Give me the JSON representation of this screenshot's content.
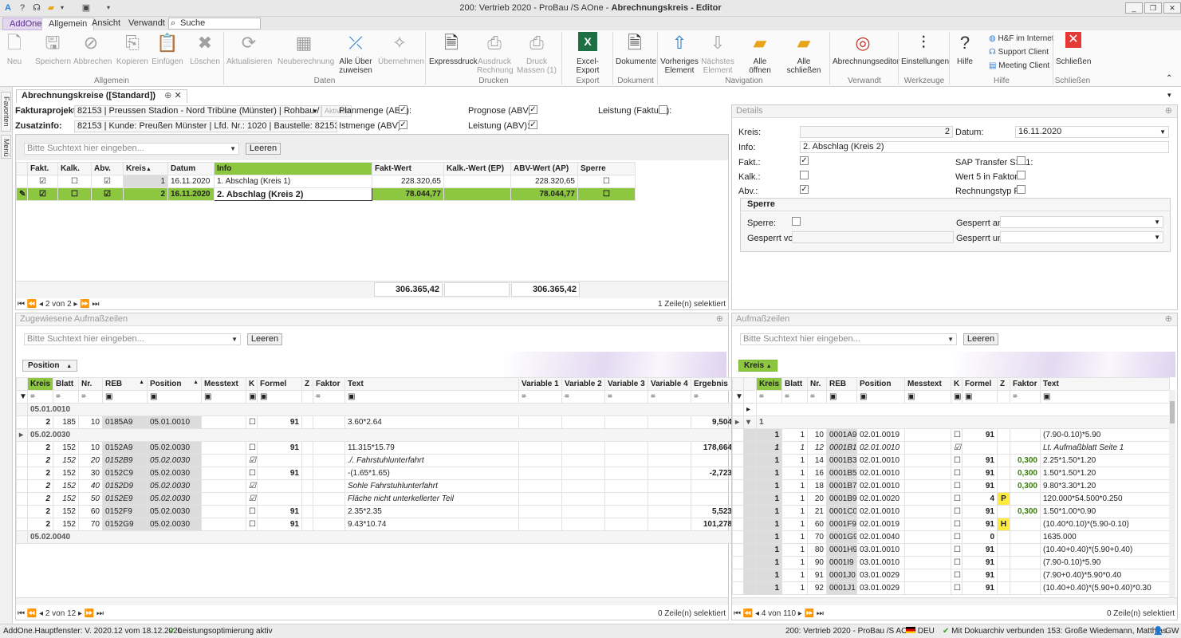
{
  "app": {
    "title": "200: Vertrieb 2020 - ProBau /S AOne - Abrechnungskreis - Editor",
    "title_prefix": "200: Vertrieb 2020 - ProBau /S AOne - ",
    "title_bold": "Abrechnungskreis - Editor"
  },
  "ribbon_tabs": [
    "AddOne",
    "Allgemein",
    "Ansicht",
    "Verwandt"
  ],
  "ribbon_search": "Suche",
  "ribbon": {
    "allgemein": [
      "Neu",
      "Speichern",
      "Abbrechen",
      "Kopieren",
      "Einfügen",
      "Löschen"
    ],
    "daten": [
      "Aktualisieren",
      "Neuberechnung",
      "Alle Über zuweisen",
      "Übernehmen"
    ],
    "drucken": [
      "Expressdruck",
      "Ausdruck Rechnung",
      "Druck Massen (1)"
    ],
    "export": "Excel-Export",
    "dokument": "Dokumente",
    "navigation": [
      "Vorheriges Element",
      "Nächstes Element",
      "Alle öffnen",
      "Alle schließen"
    ],
    "verwandt": "Abrechnungseditor",
    "werkzeuge": "Einstellungen",
    "hilfe": "Hilfe",
    "hilfe_links": [
      "H&F im Internet",
      "Support Client",
      "Meeting Client"
    ],
    "schliessen": "Schließen",
    "groups": [
      "Allgemein",
      "Daten",
      "Drucken",
      "Export",
      "Dokument",
      "Navigation",
      "Verwandt",
      "Werkzeuge",
      "Hilfe",
      "Schließen"
    ]
  },
  "side_tabs": [
    "Favoriten",
    "Menü"
  ],
  "doc_tab": "Abrechnungskreise ([Standard])",
  "top": {
    "fakturaprojekt_label": "Fakturaprojekt:",
    "fakturaprojekt": "82153 | Preussen Stadion - Nord Tribüne (Münster) | Rohbau / Erdarbeiten",
    "aktiviert": "Aktiviert",
    "zusatzinfo_label": "Zusatzinfo:",
    "zusatzinfo": "82153 | Kunde: Preußen Münster | Lfd. Nr.: 1020 | Baustelle: 82153",
    "planmenge": "Planmenge (ABV):",
    "istmenge": "Istmenge (ABV):",
    "prognose": "Prognose (ABV):",
    "leistung_abv": "Leistung (ABV):",
    "leistung_faktura": "Leistung (Faktura):",
    "search_placeholder": "Bitte Suchtext hier eingeben...",
    "leeren": "Leeren",
    "columns": [
      "Fakt.",
      "Kalk.",
      "Abv.",
      "Kreis",
      "Datum",
      "Info",
      "Fakt-Wert",
      "Kalk.-Wert (EP)",
      "ABV-Wert (AP)",
      "Sperre"
    ],
    "rows": [
      {
        "fakt": true,
        "kalk": false,
        "abv": true,
        "kreis": "1",
        "datum": "16.11.2020",
        "info": "1. Abschlag (Kreis 1)",
        "fakt_wert": "228.320,65",
        "kalk_wert": "",
        "abv_wert": "228.320,65",
        "sperre": false
      },
      {
        "fakt": true,
        "kalk": false,
        "abv": true,
        "kreis": "2",
        "datum": "16.11.2020",
        "info": "2. Abschlag (Kreis 2)",
        "fakt_wert": "78.044,77",
        "kalk_wert": "",
        "abv_wert": "78.044,77",
        "sperre": false
      }
    ],
    "sum_fakt": "306.365,42",
    "sum_abv": "306.365,42",
    "nav": "2 von 2",
    "selected": "1 Zeile(n) selektiert"
  },
  "details": {
    "title": "Details",
    "kreis_label": "Kreis:",
    "kreis": "2",
    "datum_label": "Datum:",
    "datum": "16.11.2020",
    "info_label": "Info:",
    "info": "2. Abschlag (Kreis 2)",
    "fakt": "Fakt.:",
    "kalk": "Kalk.:",
    "abv": "Abv.:",
    "sap": "SAP Transfer SS11:",
    "wert5": "Wert 5 in Faktor:",
    "rechnungstyp": "Rechnungstyp R:",
    "sperre_title": "Sperre",
    "sperre": "Sperre:",
    "gesperrt_am": "Gesperrt am:",
    "gesperrt_von": "Gesperrt von:",
    "gesperrt_um": "Gesperrt um:"
  },
  "left_grid": {
    "title": "Zugewiesene Aufmaßzeilen",
    "search_placeholder": "Bitte Suchtext hier eingeben...",
    "leeren": "Leeren",
    "group_chip": "Position",
    "columns": [
      "Kreis",
      "Blatt",
      "Nr.",
      "REB",
      "Position",
      "Messtext",
      "K",
      "Formel",
      "Z",
      "Faktor",
      "Text",
      "Variable 1",
      "Variable 2",
      "Variable 3",
      "Variable 4",
      "Ergebnis"
    ],
    "groups": [
      {
        "name": "05.01.0010",
        "rows": [
          {
            "kreis": "2",
            "blatt": "185",
            "nr": "10",
            "reb": "0185A9",
            "pos": "05.01.0010",
            "k": false,
            "formel": "91",
            "text": "3.60*2.64",
            "erg": "9,504",
            "it": false
          }
        ]
      },
      {
        "name": "05.02.0030",
        "rows": [
          {
            "kreis": "2",
            "blatt": "152",
            "nr": "10",
            "reb": "0152A9",
            "pos": "05.02.0030",
            "k": false,
            "formel": "91",
            "text": "11.315*15.79",
            "erg": "178,664",
            "it": false
          },
          {
            "kreis": "2",
            "blatt": "152",
            "nr": "20",
            "reb": "0152B9",
            "pos": "05.02.0030",
            "k": true,
            "formel": "",
            "text": "./. Fahrstuhlunterfahrt",
            "erg": "",
            "it": true
          },
          {
            "kreis": "2",
            "blatt": "152",
            "nr": "30",
            "reb": "0152C9",
            "pos": "05.02.0030",
            "k": false,
            "formel": "91",
            "text": "-(1.65*1.65)",
            "erg": "-2,723",
            "it": false
          },
          {
            "kreis": "2",
            "blatt": "152",
            "nr": "40",
            "reb": "0152D9",
            "pos": "05.02.0030",
            "k": true,
            "formel": "",
            "text": "Sohle Fahrstuhlunterfahrt",
            "erg": "",
            "it": true
          },
          {
            "kreis": "2",
            "blatt": "152",
            "nr": "50",
            "reb": "0152E9",
            "pos": "05.02.0030",
            "k": true,
            "formel": "",
            "text": "Fläche nicht unterkellerter Teil",
            "erg": "",
            "it": true
          },
          {
            "kreis": "2",
            "blatt": "152",
            "nr": "60",
            "reb": "0152F9",
            "pos": "05.02.0030",
            "k": false,
            "formel": "91",
            "text": "2.35*2.35",
            "erg": "5,523",
            "it": false
          },
          {
            "kreis": "2",
            "blatt": "152",
            "nr": "70",
            "reb": "0152G9",
            "pos": "05.02.0030",
            "k": false,
            "formel": "91",
            "text": "9.43*10.74",
            "erg": "101,278",
            "it": false
          }
        ]
      },
      {
        "name": "05.02.0040",
        "rows": []
      }
    ],
    "nav": "2 von 12",
    "selected": "0 Zeile(n) selektiert"
  },
  "right_grid": {
    "title": "Aufmaßzeilen",
    "search_placeholder": "Bitte Suchtext hier eingeben...",
    "leeren": "Leeren",
    "group_chip": "Kreis",
    "group1": "1",
    "columns": [
      "Kreis",
      "Blatt",
      "Nr.",
      "REB",
      "Position",
      "Messtext",
      "K",
      "Formel",
      "Z",
      "Faktor",
      "Text"
    ],
    "rows": [
      {
        "kreis": "1",
        "blatt": "1",
        "nr": "10",
        "reb": "0001A9",
        "pos": "02.01.0019",
        "k": false,
        "formel": "91",
        "z": "",
        "faktor": "",
        "text": "(7.90-0.10)*5.90",
        "it": false
      },
      {
        "kreis": "1",
        "blatt": "1",
        "nr": "12",
        "reb": "0001B1",
        "pos": "02.01.0010",
        "k": true,
        "formel": "",
        "z": "",
        "faktor": "",
        "text": "Lt. Aufmaßblatt Seite 1",
        "it": true
      },
      {
        "kreis": "1",
        "blatt": "1",
        "nr": "14",
        "reb": "0001B3",
        "pos": "02.01.0010",
        "k": false,
        "formel": "91",
        "z": "",
        "faktor": "0,300",
        "text": "2.25*1.50*1.20",
        "it": false
      },
      {
        "kreis": "1",
        "blatt": "1",
        "nr": "16",
        "reb": "0001B5",
        "pos": "02.01.0010",
        "k": false,
        "formel": "91",
        "z": "",
        "faktor": "0,300",
        "text": "1.50*1.50*1.20",
        "it": false
      },
      {
        "kreis": "1",
        "blatt": "1",
        "nr": "18",
        "reb": "0001B7",
        "pos": "02.01.0010",
        "k": false,
        "formel": "91",
        "z": "",
        "faktor": "0,300",
        "text": "9.80*3.30*1.20",
        "it": false
      },
      {
        "kreis": "1",
        "blatt": "1",
        "nr": "20",
        "reb": "0001B9",
        "pos": "02.01.0020",
        "k": false,
        "formel": "4",
        "z": "P",
        "faktor": "",
        "text": "120.000*54.500*0.250",
        "it": false
      },
      {
        "kreis": "1",
        "blatt": "1",
        "nr": "21",
        "reb": "0001C0",
        "pos": "02.01.0010",
        "k": false,
        "formel": "91",
        "z": "",
        "faktor": "0,300",
        "text": "1.50*1.00*0.90",
        "it": false
      },
      {
        "kreis": "1",
        "blatt": "1",
        "nr": "60",
        "reb": "0001F9",
        "pos": "02.01.0019",
        "k": false,
        "formel": "91",
        "z": "H",
        "faktor": "",
        "text": "(10.40*0.10)*(5.90-0.10)",
        "it": false
      },
      {
        "kreis": "1",
        "blatt": "1",
        "nr": "70",
        "reb": "0001G9",
        "pos": "02.01.0040",
        "k": false,
        "formel": "0",
        "z": "",
        "faktor": "",
        "text": "1635.000",
        "it": false
      },
      {
        "kreis": "1",
        "blatt": "1",
        "nr": "80",
        "reb": "0001H9",
        "pos": "03.01.0010",
        "k": false,
        "formel": "91",
        "z": "",
        "faktor": "",
        "text": "(10.40+0.40)*(5.90+0.40)",
        "it": false
      },
      {
        "kreis": "1",
        "blatt": "1",
        "nr": "90",
        "reb": "0001I9",
        "pos": "03.01.0010",
        "k": false,
        "formel": "91",
        "z": "",
        "faktor": "",
        "text": "(7.90-0.10)*5.90",
        "it": false
      },
      {
        "kreis": "1",
        "blatt": "1",
        "nr": "91",
        "reb": "0001J0",
        "pos": "03.01.0029",
        "k": false,
        "formel": "91",
        "z": "",
        "faktor": "",
        "text": "(7.90+0.40)*5.90*0.40",
        "it": false
      },
      {
        "kreis": "1",
        "blatt": "1",
        "nr": "92",
        "reb": "0001J1",
        "pos": "03.01.0029",
        "k": false,
        "formel": "91",
        "z": "",
        "faktor": "",
        "text": "(10.40+0.40)*(5.90+0.40)*0.30",
        "it": false
      }
    ],
    "nav": "4 von 110",
    "selected": "0 Zeile(n) selektiert"
  },
  "status": {
    "left": "AddOne.Hauptfenster: V. 2020.12 vom 18.12.2020",
    "opt": "Leistungsoptimierung aktiv",
    "db": "200: Vertrieb 2020 - ProBau /S AOne",
    "lang": "DEU",
    "archiv": "Mit Dokuarchiv verbunden",
    "user": "153: Große Wiedemann, Matthias",
    "init": "GW"
  },
  "colors": {
    "accent": "#8dc63f",
    "addone": "#e3d6ef",
    "highlight": "#ffeb3b"
  }
}
